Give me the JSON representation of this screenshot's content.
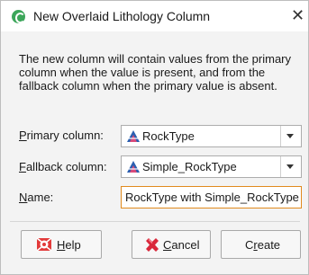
{
  "window": {
    "title": "New Overlaid Lithology Column"
  },
  "description": "The new column will contain values from the primary column when the value is present, and from the fallback column when the primary value is absent.",
  "primary": {
    "label_key": "P",
    "label_rest": "rimary column:",
    "value": "RockType"
  },
  "fallback": {
    "label_key": "F",
    "label_rest": "allback column:",
    "value": "Simple_RockType"
  },
  "name": {
    "label_key": "N",
    "label_rest": "ame:",
    "value": "RockType with Simple_RockType"
  },
  "buttons": {
    "help_key": "H",
    "help_rest": "elp",
    "cancel_key": "C",
    "cancel_rest": "ancel",
    "create_pre": "C",
    "create_key": "r",
    "create_rest": "eate"
  },
  "colors": {
    "accent": "#e08a1e",
    "app_icon": "#3ca65a",
    "lithology_icon": "#2a5fb0"
  },
  "icons": {
    "app": "leapfrog-icon",
    "close": "close-icon",
    "column": "lithology-column-icon",
    "help": "help-icon",
    "cancel": "cancel-icon"
  }
}
